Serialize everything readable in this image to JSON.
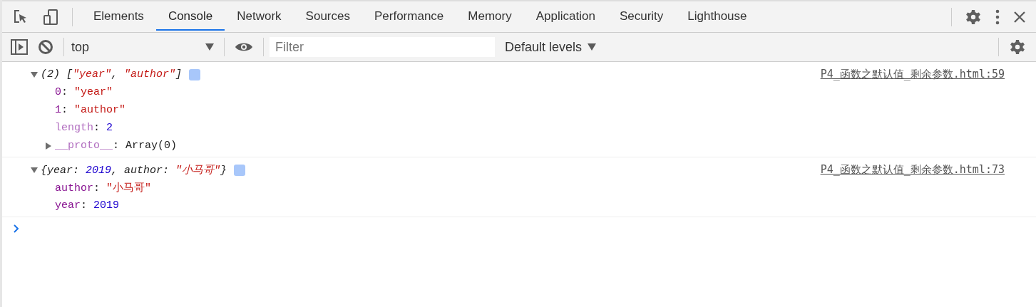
{
  "tabs": [
    {
      "label": "Elements",
      "selected": false
    },
    {
      "label": "Console",
      "selected": true
    },
    {
      "label": "Network",
      "selected": false
    },
    {
      "label": "Sources",
      "selected": false
    },
    {
      "label": "Performance",
      "selected": false
    },
    {
      "label": "Memory",
      "selected": false
    },
    {
      "label": "Application",
      "selected": false
    },
    {
      "label": "Security",
      "selected": false
    },
    {
      "label": "Lighthouse",
      "selected": false
    }
  ],
  "console_toolbar": {
    "context": "top",
    "filter": {
      "placeholder": "Filter"
    },
    "levels": "Default levels"
  },
  "messages": [
    {
      "expanded": true,
      "source": "P4_函数之默认值_剩余参数.html:59",
      "summary": [
        {
          "text": "(2) [",
          "kind": "plain"
        },
        {
          "text": "\"year\"",
          "kind": "string"
        },
        {
          "text": ", ",
          "kind": "plain"
        },
        {
          "text": "\"author\"",
          "kind": "string"
        },
        {
          "text": "]",
          "kind": "plain"
        }
      ],
      "properties": [
        {
          "kind": "value",
          "tokens": [
            {
              "text": "0",
              "kind": "key"
            },
            {
              "text": ": ",
              "kind": "plain"
            },
            {
              "text": "\"year\"",
              "kind": "string"
            }
          ]
        },
        {
          "kind": "value",
          "tokens": [
            {
              "text": "1",
              "kind": "key"
            },
            {
              "text": ": ",
              "kind": "plain"
            },
            {
              "text": "\"author\"",
              "kind": "string"
            }
          ]
        },
        {
          "kind": "value",
          "tokens": [
            {
              "text": "length",
              "kind": "dim_key"
            },
            {
              "text": ": ",
              "kind": "plain"
            },
            {
              "text": "2",
              "kind": "number"
            }
          ]
        },
        {
          "kind": "object",
          "expanded": false,
          "tokens": [
            {
              "text": "__proto__",
              "kind": "dim_key"
            },
            {
              "text": ": Array(0)",
              "kind": "plain"
            }
          ]
        }
      ]
    },
    {
      "expanded": true,
      "source": "P4_函数之默认值_剩余参数.html:73",
      "summary": [
        {
          "text": "{year: ",
          "kind": "plain"
        },
        {
          "text": "2019",
          "kind": "number"
        },
        {
          "text": ", author: ",
          "kind": "plain"
        },
        {
          "text": "\"小马哥\"",
          "kind": "string"
        },
        {
          "text": "}",
          "kind": "plain"
        }
      ],
      "properties": [
        {
          "kind": "value",
          "tokens": [
            {
              "text": "author",
              "kind": "key"
            },
            {
              "text": ": ",
              "kind": "plain"
            },
            {
              "text": "\"小马哥\"",
              "kind": "string"
            }
          ]
        },
        {
          "kind": "value",
          "tokens": [
            {
              "text": "year",
              "kind": "key"
            },
            {
              "text": ": ",
              "kind": "plain"
            },
            {
              "text": "2019",
              "kind": "number"
            }
          ]
        }
      ]
    }
  ]
}
